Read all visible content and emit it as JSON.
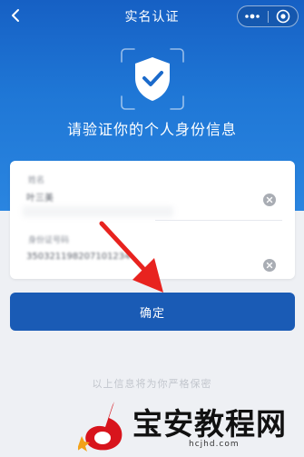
{
  "header": {
    "title": "实名认证",
    "more_icon": "more-dots-icon",
    "close_icon": "target-circle-icon",
    "back_icon": "chevron-left-icon"
  },
  "hero": {
    "icon": "shield-check-icon",
    "heading": "请验证你的个人身份信息"
  },
  "form": {
    "fields": [
      {
        "label": "姓名",
        "value": "叶三美",
        "clear_icon": "clear-icon"
      },
      {
        "label": "身份证号码",
        "value": "350321198207101234",
        "clear_icon": "clear-icon"
      }
    ]
  },
  "actions": {
    "confirm_label": "确定"
  },
  "footer": {
    "note": "以上信息将为你严格保密"
  },
  "overlay": {
    "annotation_icon": "red-arrow-icon"
  },
  "watermark": {
    "brand": "宝安教程网",
    "url": "hcjhd.com"
  },
  "colors": {
    "primary": "#1a5bb5",
    "hero_top": "#1660c4",
    "hero_bottom": "#2a85e0",
    "background": "#eef0f4",
    "arrow": "#e8231f"
  }
}
